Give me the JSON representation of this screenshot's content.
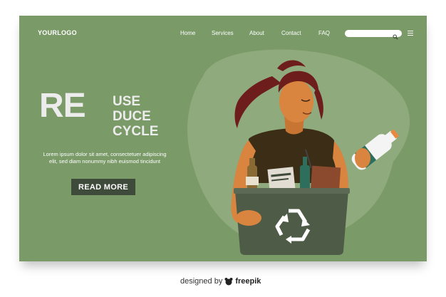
{
  "header": {
    "logo": "YOURLOGO",
    "nav": [
      "Home",
      "Services",
      "About",
      "Contact",
      "FAQ"
    ],
    "search_placeholder": "",
    "search_icon": "search-icon",
    "menu_icon": "hamburger-menu-icon"
  },
  "hero": {
    "big_letters": "RE",
    "words": [
      "USE",
      "DUCE",
      "CYCLE"
    ],
    "body": "Lorem ipsum dolor sit amet, consectetuer adipiscing elit, sed diam nonummy nibh euismod tincidunt",
    "cta": "READ MORE"
  },
  "footer_credit": {
    "prefix": "designed by",
    "brand": "freepik"
  },
  "colors": {
    "background": "#7a9a68",
    "blob": "#8faa7c",
    "button": "#3e4a3a",
    "hair": "#6e1d1d",
    "skin": "#d9843f",
    "bin": "#4e5b47"
  }
}
